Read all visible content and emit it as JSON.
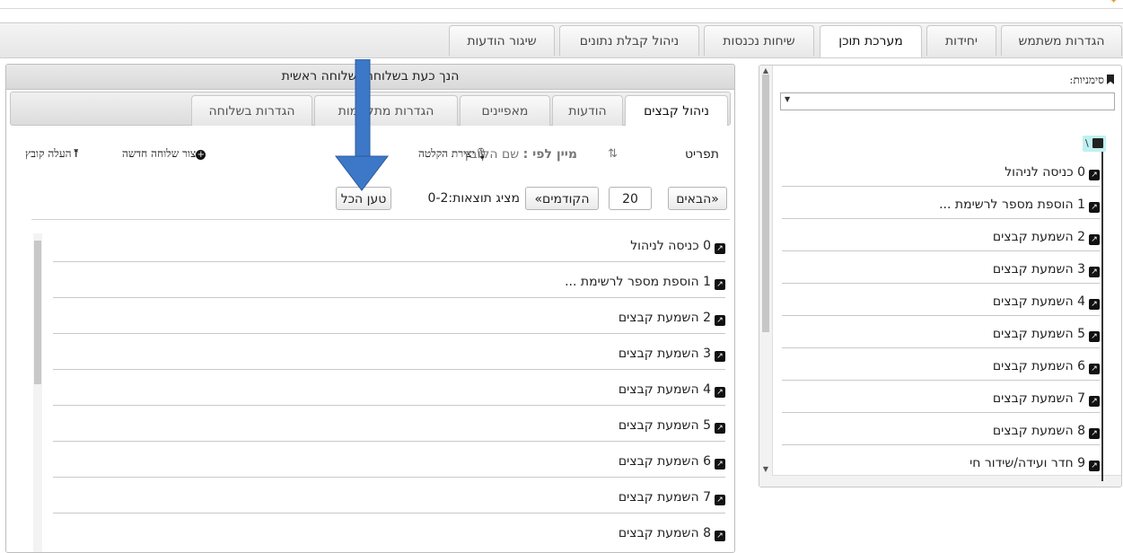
{
  "main_tabs": [
    {
      "label": "הגדרות משתמש"
    },
    {
      "label": "יחידות"
    },
    {
      "label": "מערכת תוכן"
    },
    {
      "label": "שיחות נכנסות"
    },
    {
      "label": "ניהול קבלת נתונים"
    },
    {
      "label": "שיגור הודעות"
    }
  ],
  "active_main_tab": "מערכת תוכן",
  "sidebar": {
    "bookmarks_label": "סימניות:",
    "bookmarks_value": "",
    "root_label": "\\",
    "items": [
      {
        "label": "0 כניסה לניהול"
      },
      {
        "label": "1 הוספת מספר לרשימת ..."
      },
      {
        "label": "2 השמעת קבצים"
      },
      {
        "label": "3 השמעת קבצים"
      },
      {
        "label": "4 השמעת קבצים"
      },
      {
        "label": "5 השמעת קבצים"
      },
      {
        "label": "6 השמעת קבצים"
      },
      {
        "label": "7 השמעת קבצים"
      },
      {
        "label": "8 השמעת קבצים"
      },
      {
        "label": "9 חדר ועידה/שידור חי"
      }
    ]
  },
  "content": {
    "header": "הנך כעת בשלוחה: שלוחה ראשית",
    "sub_tabs": [
      {
        "label": "ניהול קבצים"
      },
      {
        "label": "הודעות"
      },
      {
        "label": "מאפיינים"
      },
      {
        "label": "הגדרות מתקדמות"
      },
      {
        "label": "הגדרות בשלוחה"
      }
    ],
    "toolbar": {
      "menu_label": "תפריט",
      "sort_label": "מיין לפי :",
      "sort_value": "שם הקובץ",
      "record_label": "יצירת הקלטה",
      "new_ext_label": "צור שלוחה חדשה",
      "upload_label": "העלה קובץ"
    },
    "pager": {
      "next_label": "«הבאים",
      "page_size": "20",
      "prev_label": "הקודמים»",
      "results_text": "מציג תוצאות:0-2",
      "load_all_label": "טען הכל"
    },
    "files": [
      {
        "label": "0 כניסה לניהול"
      },
      {
        "label": "1 הוספת מספר לרשימת ..."
      },
      {
        "label": "2 השמעת קבצים"
      },
      {
        "label": "3 השמעת קבצים"
      },
      {
        "label": "4 השמעת קבצים"
      },
      {
        "label": "5 השמעת קבצים"
      },
      {
        "label": "6 השמעת קבצים"
      },
      {
        "label": "7 השמעת קבצים"
      },
      {
        "label": "8 השמעת קבצים"
      }
    ]
  },
  "colors": {
    "annotation_arrow": "#3d78c8",
    "tree_root_highlight": "#bff0f0"
  },
  "icons": {
    "item_icon": "external-link-icon",
    "sort_icon": "sort-icon",
    "mic_icon": "microphone-icon",
    "plus_icon": "plus-circle-icon",
    "upload_icon": "upload-icon",
    "bookmark_icon": "bookmark-icon"
  }
}
